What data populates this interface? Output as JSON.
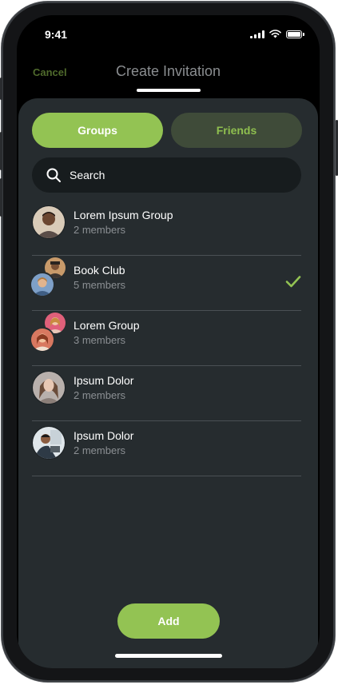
{
  "status": {
    "time": "9:41"
  },
  "header": {
    "cancel_label": "Cancel",
    "title": "Create Invitation"
  },
  "tabs": {
    "groups_label": "Groups",
    "friends_label": "Friends",
    "active": "Groups"
  },
  "search": {
    "placeholder": "Search",
    "icon": "search-icon"
  },
  "groups": [
    {
      "name": "Lorem Ipsum Group",
      "members": "2 members",
      "selected": false,
      "avatars": 1
    },
    {
      "name": "Book Club",
      "members": "5 members",
      "selected": true,
      "avatars": 2
    },
    {
      "name": "Lorem Group",
      "members": "3 members",
      "selected": false,
      "avatars": 2
    },
    {
      "name": "Ipsum Dolor",
      "members": "2 members",
      "selected": false,
      "avatars": 1
    },
    {
      "name": "Ipsum Dolor",
      "members": "2 members",
      "selected": false,
      "avatars": 1
    }
  ],
  "actions": {
    "add_label": "Add"
  },
  "colors": {
    "accent": "#93c353",
    "sheet": "#262c2f",
    "background": "#000000"
  }
}
